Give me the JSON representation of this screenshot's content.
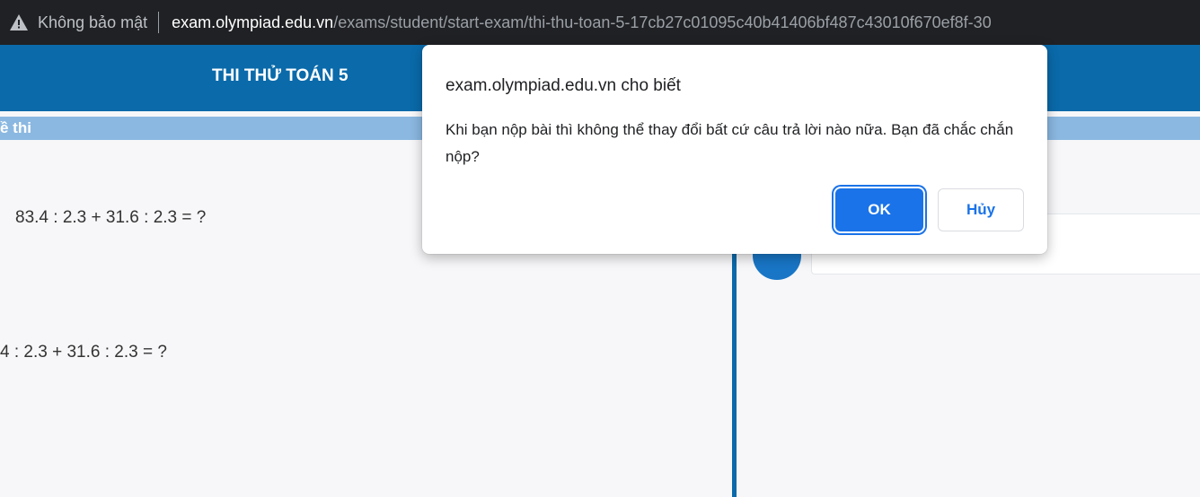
{
  "browser": {
    "security_label": "Không bảo mật",
    "url_host": "exam.olympiad.edu.vn",
    "url_path": "/exams/student/start-exam/thi-thu-toan-5-17cb27c01095c40b41406bf487c43010f670ef8f-30"
  },
  "exam": {
    "title": "THI THỬ TOÁN 5",
    "section_label": "ề thi",
    "question_1": "83.4 : 2.3 + 31.6 : 2.3 = ?",
    "question_2": "4 : 2.3 + 31.6 : 2.3 = ?"
  },
  "dialog": {
    "title": "exam.olympiad.edu.vn cho biết",
    "message": "Khi bạn nộp bài thì không thể thay đổi bất cứ câu trả lời nào nữa. Bạn đã chắc chắn nộp?",
    "ok_label": "OK",
    "cancel_label": "Hủy"
  },
  "colors": {
    "header": "#0a6aaa",
    "subbar": "#8bb8e1",
    "primary_button": "#1a73e8"
  },
  "icons": {
    "security": "warning-triangle-icon"
  }
}
